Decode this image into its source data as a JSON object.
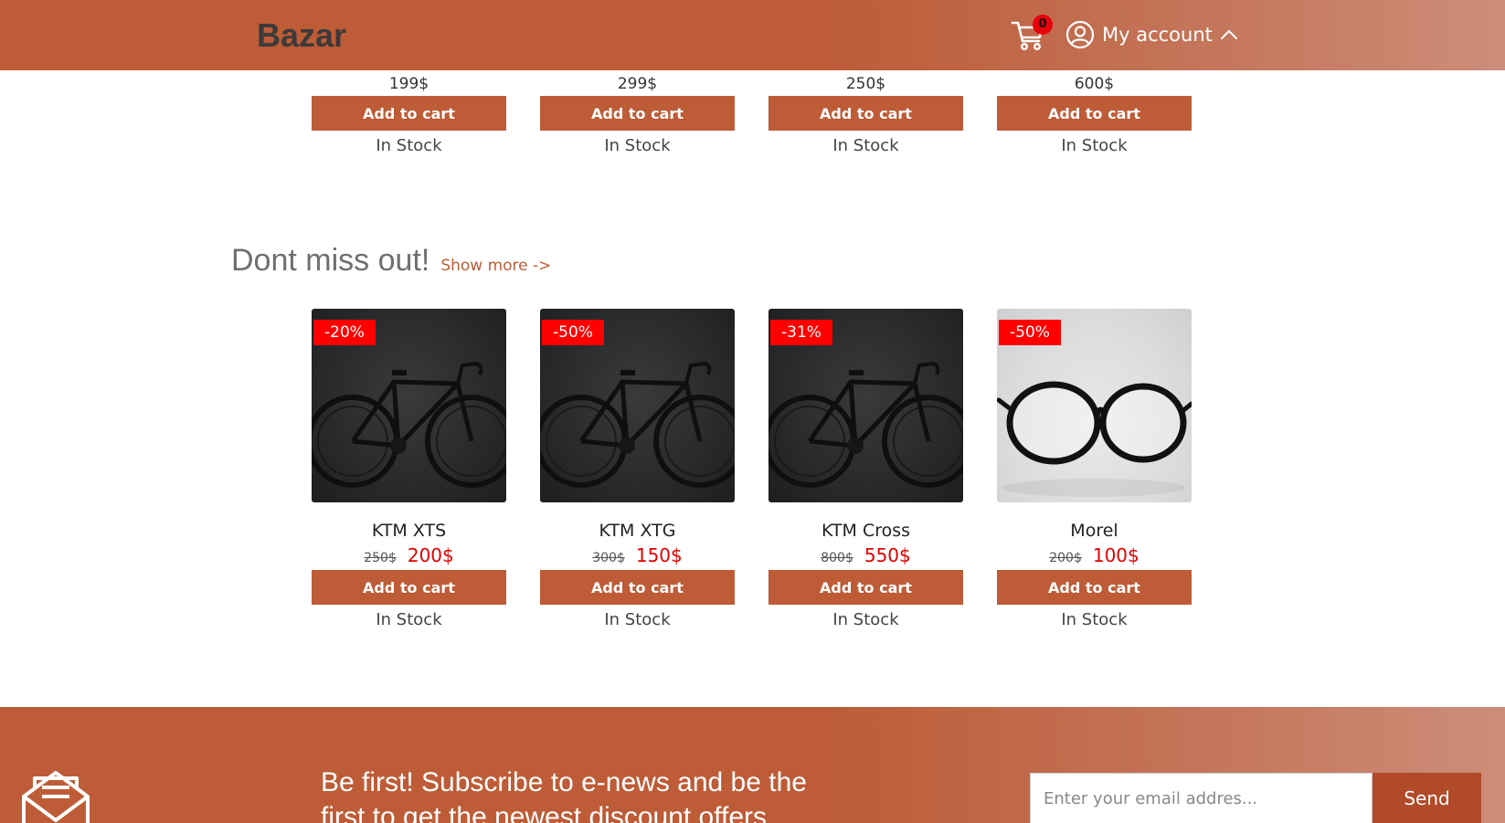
{
  "header": {
    "logo": "Bazar",
    "cart_count": "0",
    "account_label": "My account",
    "cart_icon": "cart-icon",
    "account_icon": "user-circle-icon",
    "chevron_icon": "chevron-up-icon"
  },
  "top_products": [
    {
      "price": "199$",
      "button": "Add to cart",
      "stock": "In Stock"
    },
    {
      "price": "299$",
      "button": "Add to cart",
      "stock": "In Stock"
    },
    {
      "price": "250$",
      "button": "Add to cart",
      "stock": "In Stock"
    },
    {
      "price": "600$",
      "button": "Add to cart",
      "stock": "In Stock"
    }
  ],
  "sale_section": {
    "title": "Dont miss out!",
    "show_more": "Show more ->",
    "products": [
      {
        "discount": "-20%",
        "name": "KTM XTS",
        "old_price": "250$",
        "new_price": "200$",
        "button": "Add to cart",
        "stock": "In Stock",
        "image": "bicycle"
      },
      {
        "discount": "-50%",
        "name": "KTM XTG",
        "old_price": "300$",
        "new_price": "150$",
        "button": "Add to cart",
        "stock": "In Stock",
        "image": "bicycle"
      },
      {
        "discount": "-31%",
        "name": "KTM Cross",
        "old_price": "800$",
        "new_price": "550$",
        "button": "Add to cart",
        "stock": "In Stock",
        "image": "bicycle"
      },
      {
        "discount": "-50%",
        "name": "Morel",
        "old_price": "200$",
        "new_price": "100$",
        "button": "Add to cart",
        "stock": "In Stock",
        "image": "glasses"
      }
    ]
  },
  "footer": {
    "subscribe_text": "Be first! Subscribe to e-news and be the first to get the newest discount offers",
    "email_placeholder": "Enter your email addres...",
    "send_label": "Send",
    "mail_icon": "mail-icon"
  },
  "colors": {
    "brand": "#bd5c37",
    "discount_badge": "#ff0000",
    "sale_price": "#e30000",
    "cart_badge": "#e8000b"
  }
}
